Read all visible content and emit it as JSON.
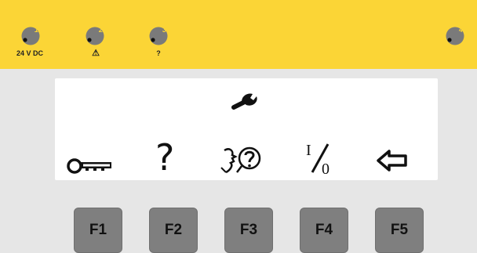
{
  "indicators": [
    {
      "number": "1",
      "caption": "24 V DC"
    },
    {
      "number": "2",
      "caption": "⚠"
    },
    {
      "number": "3",
      "caption": "?"
    },
    {
      "number": "4",
      "caption": ""
    }
  ],
  "display": {
    "header_icon": "wrench-icon",
    "soft_labels": [
      {
        "icon": "key-icon",
        "text": ""
      },
      {
        "icon": "question-icon",
        "text": "?"
      },
      {
        "icon": "help-person-icon",
        "text": ""
      },
      {
        "icon": "io-icon",
        "text": "I/0"
      },
      {
        "icon": "back-arrow-icon",
        "text": ""
      }
    ]
  },
  "function_keys": [
    {
      "label": "F1"
    },
    {
      "label": "F2"
    },
    {
      "label": "F3"
    },
    {
      "label": "F4"
    },
    {
      "label": "F5"
    }
  ],
  "colors": {
    "panel": "#fbd536",
    "background": "#e6e6e6",
    "screen": "#ffffff",
    "led": "#7a7a7a",
    "led_number": "#fbd536",
    "key": "#7f7f7f"
  }
}
